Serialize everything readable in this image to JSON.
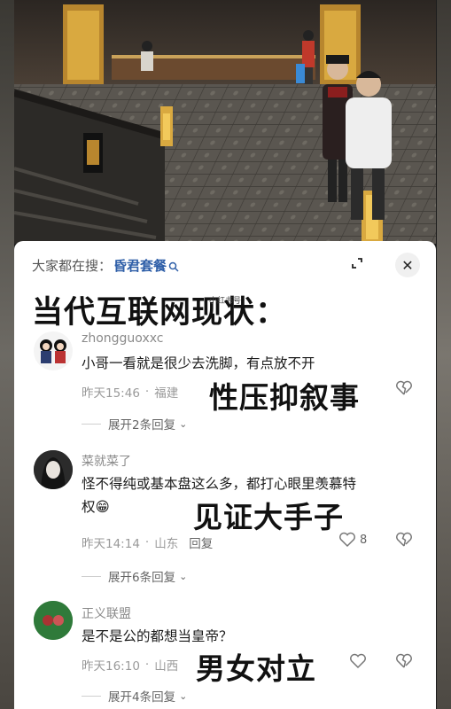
{
  "search": {
    "prefix": "大家都在搜：",
    "term": "昏君套餐"
  },
  "headline": "当代互联网现状：",
  "watermark_small": "小红书号",
  "comments": [
    {
      "username": "zhongguoxxc",
      "text": "小哥一看就是很少去洗脚，有点放不开",
      "time": "昨天15:46",
      "location": "福建",
      "reply_label": "回复",
      "like_count": "",
      "expand_replies": "展开2条回复",
      "overlay": "性压抑叙事"
    },
    {
      "username": "菜就菜了",
      "text_line1": "怪不得纯或基本盘这么多，都打心眼里羡慕特",
      "text_line2": "权",
      "emoji": "😁",
      "time": "昨天14:14",
      "location": "山东",
      "reply_label": "回复",
      "like_count": "8",
      "expand_replies": "展开6条回复",
      "overlay": "见证大手子"
    },
    {
      "username": "正义联盟",
      "text": "是不是公的都想当皇帝？",
      "time": "昨天16:10",
      "location": "山西",
      "reply_label": "回复",
      "like_count": "",
      "expand_replies": "展开4条回复",
      "overlay": "男女对立"
    }
  ],
  "colors": {
    "search_term": "#2f5fa8",
    "card_bg": "#ffffff",
    "muted_text": "#9a9a9a"
  },
  "icons": [
    "search-icon",
    "expand-icon",
    "close-icon",
    "heart-icon",
    "broken-heart-icon",
    "chevron-down-icon"
  ]
}
